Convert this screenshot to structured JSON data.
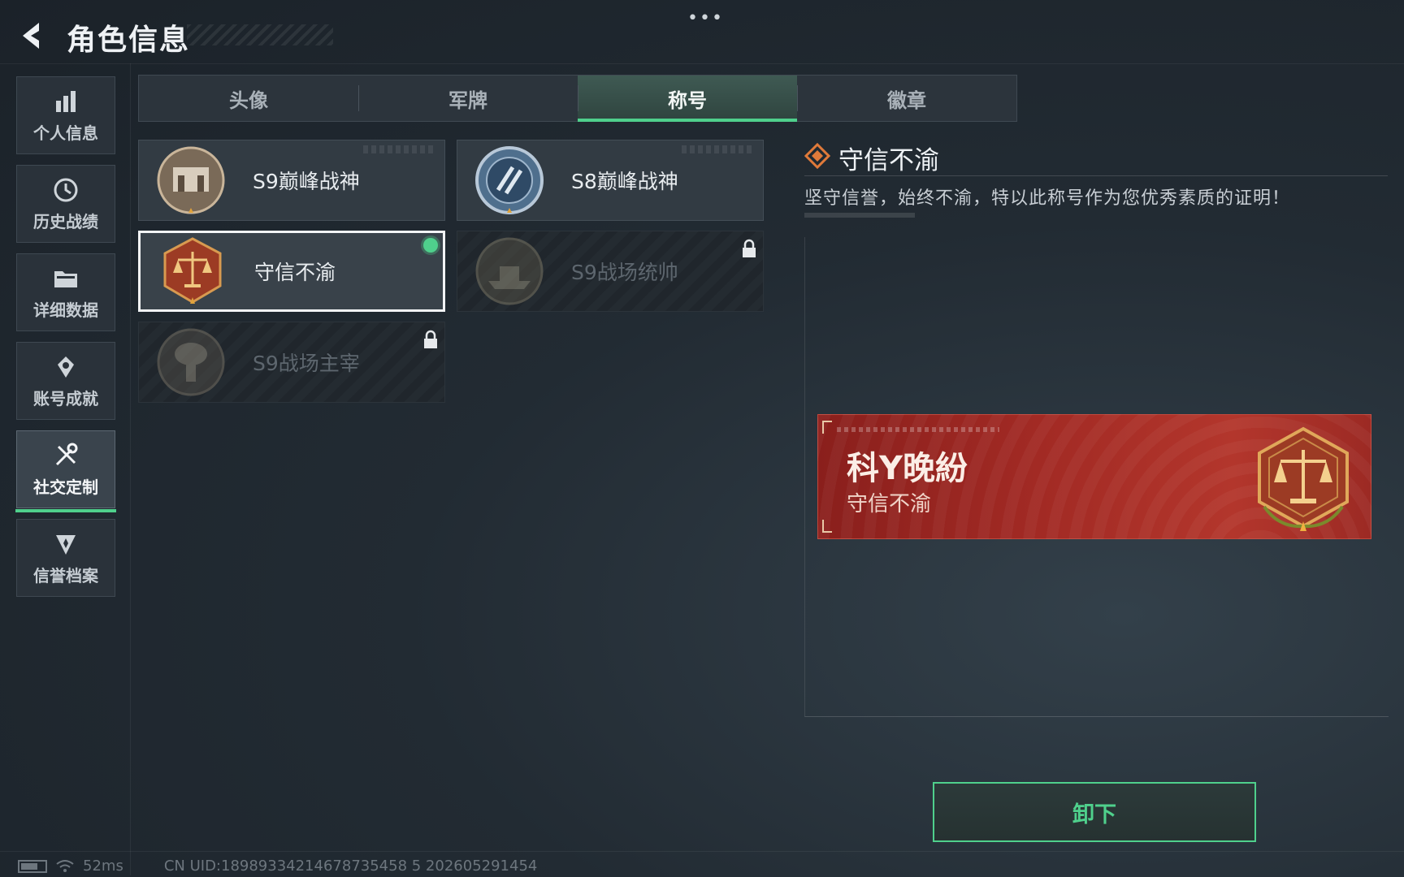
{
  "header": {
    "title": "角色信息"
  },
  "sidebar": {
    "items": [
      {
        "label": "个人信息",
        "icon": "bar-chart-icon",
        "active": false
      },
      {
        "label": "历史战绩",
        "icon": "history-clock-icon",
        "active": false
      },
      {
        "label": "详细数据",
        "icon": "folder-icon",
        "active": false
      },
      {
        "label": "账号成就",
        "icon": "achievement-icon",
        "active": false
      },
      {
        "label": "社交定制",
        "icon": "wrench-screwdriver-icon",
        "active": true
      },
      {
        "label": "信誉档案",
        "icon": "credit-badge-icon",
        "active": false
      }
    ]
  },
  "tabs": [
    {
      "label": "头像",
      "active": false
    },
    {
      "label": "军牌",
      "active": false
    },
    {
      "label": "称号",
      "active": true
    },
    {
      "label": "徽章",
      "active": false
    }
  ],
  "titles": [
    {
      "name": "S9巅峰战神",
      "emblem": "fortress-emblem-icon",
      "locked": false,
      "selected": false
    },
    {
      "name": "S8巅峰战神",
      "emblem": "blue-shield-emblem-icon",
      "locked": false,
      "selected": false
    },
    {
      "name": "守信不渝",
      "emblem": "scales-emblem-icon",
      "locked": false,
      "selected": true,
      "equipped": true
    },
    {
      "name": "S9战场统帅",
      "emblem": "warship-emblem-icon",
      "locked": true,
      "selected": false
    },
    {
      "name": "S9战场主宰",
      "emblem": "mushroom-cloud-emblem-icon",
      "locked": true,
      "selected": false
    }
  ],
  "detail": {
    "title": "守信不渝",
    "description": "坚守信誉，始终不渝，特以此称号作为您优秀素质的证明！"
  },
  "nameplate": {
    "player_name": "科Y晚紛",
    "title": "守信不渝"
  },
  "actions": {
    "unequip_label": "卸下"
  },
  "status_bar": {
    "ping": "52ms",
    "uid": "CN UID:18989334214678735458 5 202605291454"
  },
  "colors": {
    "accent": "#4fd08c",
    "nameplate": "#a22a24",
    "background": "#222b33"
  }
}
